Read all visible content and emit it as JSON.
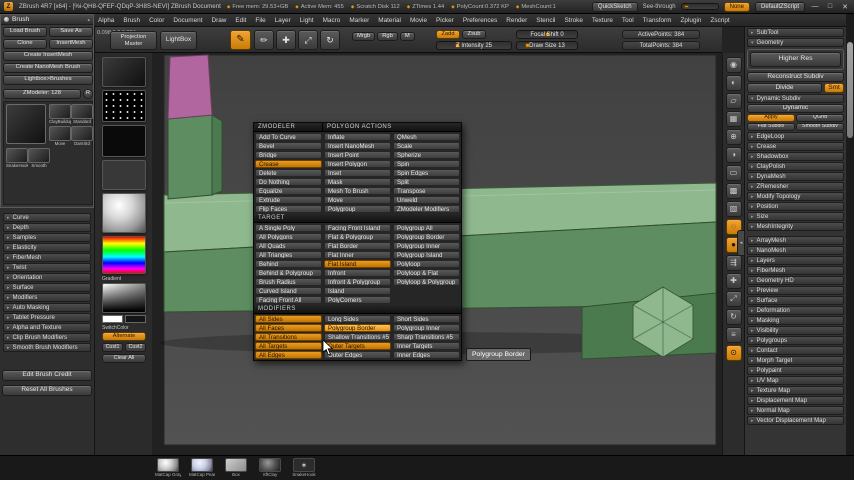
{
  "ui": {
    "stat_bullet": "◆",
    "collapse_arrow": "▸",
    "open_arrow": "▾",
    "collapse_up": "▴",
    "tray_handle": "◂",
    "r_badge": "R"
  },
  "colors": {
    "accent": "#e8930e",
    "mesh-top": "#8fb88f",
    "mesh-front": "#5d8d60",
    "mesh-side": "#4a7a4e",
    "mesh-pink": "#b266a0"
  },
  "titlebar": {
    "title": "ZBrush 4R7 [x64] - [%i-QH8-QFEF-QDqP-3H8S-NEVI]  ZBrush Document",
    "stats": [
      {
        "label": "Free mem: 29.53+GB"
      },
      {
        "label": "Active Mem: 455"
      },
      {
        "label": "Scratch Disk 112"
      },
      {
        "label": "ZTimes 1.44"
      },
      {
        "label": "PolyCount:0.372 KP"
      },
      {
        "label": "MeshCount:1"
      }
    ],
    "quicksketch": "QuickSketch",
    "see_through": "See-through",
    "none": "None",
    "zscript": "DefaultZScript",
    "win_min": "—",
    "win_max": "□",
    "win_close": "✕"
  },
  "menubar": {
    "items": [
      "Alpha",
      "Brush",
      "Color",
      "Document",
      "Draw",
      "Edit",
      "File",
      "Layer",
      "Light",
      "Macro",
      "Marker",
      "Material",
      "Movie",
      "Picker",
      "Preferences",
      "Render",
      "Stencil",
      "Stroke",
      "Texture",
      "Tool",
      "Transform",
      "Zplugin",
      "Zscript"
    ]
  },
  "shelf": {
    "coords": "0.098:0.2,0.884",
    "projection_master": "Projection Master",
    "lightbox": "LightBox",
    "edit_glyph": "✎",
    "nav": [
      {
        "name": "draw-button",
        "label": "Draw",
        "glyph": "✏"
      },
      {
        "name": "move-button",
        "label": "Move",
        "glyph": "✚"
      },
      {
        "name": "scale-button",
        "label": "Scale",
        "glyph": "⤢"
      },
      {
        "name": "rotate-button",
        "label": "Rotate",
        "glyph": "↻"
      }
    ],
    "modes": [
      "Mrgb",
      "Rgb",
      "M"
    ],
    "zadd": "Zadd",
    "zsub": "Zsub",
    "z_intensity": "Z Intensity 25",
    "focal_shift": "Focal Shift 0",
    "draw_size": "Draw Size 13",
    "active_points": "ActivePoints: 384",
    "total_points": "TotalPoints: 384"
  },
  "brush_palette": {
    "title": "Brush",
    "row1": [
      {
        "name": "load-brush-button",
        "label": "Load Brush"
      },
      {
        "name": "save-as-button",
        "label": "Save As"
      }
    ],
    "row2": [
      {
        "name": "clone-brush-button",
        "label": "Clone"
      },
      {
        "name": "insertmesh-button",
        "label": "InsertMesh"
      }
    ],
    "wide": [
      {
        "name": "create-insertmesh-button",
        "label": "Create InsertMesh"
      },
      {
        "name": "create-nanomesh-brush-button",
        "label": "Create NanoMesh Brush"
      },
      {
        "name": "lightbox-brushes-button",
        "label": "Lightbox>Brushes"
      }
    ],
    "zmodeler_count": "ZModeler: 128",
    "current_brush": "ZModeler",
    "thumbs_grid": [
      {
        "label": "ClayBuildup"
      },
      {
        "label": "Standard"
      },
      {
        "label": "Move"
      },
      {
        "label": "DamStd"
      }
    ],
    "thumbs_row": [
      {
        "label": "SnakeHook"
      },
      {
        "label": "Smooth"
      }
    ],
    "menus": [
      {
        "label": "Curve"
      },
      {
        "label": "Depth"
      },
      {
        "label": "Samples"
      },
      {
        "label": "Elasticity"
      },
      {
        "label": "FiberMesh"
      },
      {
        "label": "Twist"
      },
      {
        "label": "Orientation"
      },
      {
        "label": "Surface"
      },
      {
        "label": "Modifiers"
      },
      {
        "label": "Auto Masking"
      },
      {
        "label": "Tablet Pressure"
      },
      {
        "label": "Alpha and Texture"
      },
      {
        "label": "Clip Brush Modifiers"
      },
      {
        "label": "Smooth Brush Modifiers"
      }
    ],
    "credit": "Edit Brush Credit",
    "reset": "Reset All Brushes"
  },
  "left_shelf": {
    "gradient": "Gradient",
    "switch_color": "SwitchColor",
    "alternate": "Alternate",
    "cust": [
      "Cust1",
      "Cust2"
    ],
    "clear": "Clear All"
  },
  "zmodeler": {
    "title": "ZMODELER",
    "actions_header": "POLYGON ACTIONS",
    "actions_col1": [
      {
        "label": "Add To Curve"
      },
      {
        "label": "Bevel"
      },
      {
        "label": "Bridge"
      },
      {
        "label": "Crease",
        "on": true
      },
      {
        "label": "Delete"
      },
      {
        "label": "Do Nothing"
      },
      {
        "label": "Equalize"
      },
      {
        "label": "Extrude"
      },
      {
        "label": "Flip Faces"
      }
    ],
    "actions_col2": [
      {
        "label": "Inflate"
      },
      {
        "label": "Insert NanoMesh"
      },
      {
        "label": "Insert Point"
      },
      {
        "label": "Insert Polygon"
      },
      {
        "label": "Inset"
      },
      {
        "label": "Mask"
      },
      {
        "label": "Mesh To Brush"
      },
      {
        "label": "Move"
      },
      {
        "label": "Polygroup"
      }
    ],
    "actions_col3": [
      {
        "label": "QMesh"
      },
      {
        "label": "Scale"
      },
      {
        "label": "Spherize"
      },
      {
        "label": "Spin"
      },
      {
        "label": "Spin Edges"
      },
      {
        "label": "Split"
      },
      {
        "label": "Transpose"
      },
      {
        "label": "Unweld"
      },
      {
        "label": "ZModeler Modifiers"
      }
    ],
    "target_header": "TARGET",
    "targets_col1": [
      {
        "label": "A Single Poly"
      },
      {
        "label": "All Polygons"
      },
      {
        "label": "All Quads"
      },
      {
        "label": "All Triangles"
      },
      {
        "label": "Behind"
      },
      {
        "label": "Behind & Polygroup"
      },
      {
        "label": "Brush Radius"
      },
      {
        "label": "Curved Island"
      },
      {
        "label": "Facing Front All"
      }
    ],
    "targets_col2": [
      {
        "label": "Facing Front Island"
      },
      {
        "label": "Flat & Polygroup"
      },
      {
        "label": "Flat Border"
      },
      {
        "label": "Flat Inner"
      },
      {
        "label": "Flat Island",
        "on": true
      },
      {
        "label": "Infront"
      },
      {
        "label": "Infront & Polygroup"
      },
      {
        "label": "Island"
      },
      {
        "label": "PolyCorners"
      }
    ],
    "targets_col3": [
      {
        "label": "Polygroup All"
      },
      {
        "label": "Polygroup Border"
      },
      {
        "label": "Polygroup Inner"
      },
      {
        "label": "Polygroup Island"
      },
      {
        "label": "Polyloop"
      },
      {
        "label": "Polyloop & Flat"
      },
      {
        "label": "Polyloop & Polygroup"
      }
    ],
    "modifiers_header": "MODIFIERS",
    "modifiers_col1": [
      {
        "label": "All Sides",
        "on": true
      },
      {
        "label": "All Faces",
        "on": true
      },
      {
        "label": "All Transitions",
        "on": true
      },
      {
        "label": "All Targets",
        "on": true
      },
      {
        "label": "All Edges",
        "on": true
      }
    ],
    "modifiers_col2": [
      {
        "label": "Long Sides"
      },
      {
        "label": "Polygroup Border",
        "on": true,
        "hover": true
      },
      {
        "label": "Shallow Transitions #5"
      },
      {
        "label": "Outer Targets",
        "on": true
      },
      {
        "label": "Outer Edges"
      }
    ],
    "modifiers_col3": [
      {
        "label": "Short Sides"
      },
      {
        "label": "Polygroup Inner"
      },
      {
        "label": "Sharp Transitions #5"
      },
      {
        "label": "Inner Targets"
      },
      {
        "label": "Inner Edges"
      }
    ],
    "tooltip": "Polygroup Border"
  },
  "right_shelf": {
    "icons": [
      {
        "name": "bpr-icon",
        "glyph": "◉"
      },
      {
        "name": "render-mode-icon",
        "glyph": "◐"
      },
      {
        "name": "persp-icon",
        "glyph": "▱"
      },
      {
        "name": "floor-grid-icon",
        "glyph": "▦"
      },
      {
        "name": "local-transform-icon",
        "glyph": "⊕"
      },
      {
        "name": "lsym-icon",
        "glyph": "◑"
      },
      {
        "name": "frame-icon",
        "glyph": "▭"
      },
      {
        "name": "polyframe-icon",
        "glyph": "▩"
      },
      {
        "name": "transparency-icon",
        "glyph": "▨"
      },
      {
        "name": "ghost-icon",
        "glyph": "◌",
        "on": true
      },
      {
        "name": "solo-icon",
        "glyph": "●",
        "on": true
      },
      {
        "name": "xpose-icon",
        "glyph": "⇶"
      },
      {
        "name": "move-3d-icon",
        "glyph": "✚"
      },
      {
        "name": "scale-3d-icon",
        "glyph": "⤢"
      },
      {
        "name": "rotate-3d-icon",
        "glyph": "↻"
      },
      {
        "name": "scroll-doc-icon",
        "glyph": "≡"
      },
      {
        "name": "zoom-doc-icon",
        "glyph": "⊙",
        "on": true
      }
    ]
  },
  "right_tray": {
    "subtool": "SubTool",
    "geometry": "Geometry",
    "higher_res": "Higher Res",
    "reconstruct": "Reconstruct Subdiv",
    "divide": "Divide",
    "smt": "Smt",
    "dynamic_header": "Dynamic Subdiv",
    "dynamic": "Dynamic",
    "dyn_buttons": [
      {
        "label": "Apply",
        "on": true
      },
      {
        "label": "QGrid"
      },
      {
        "label": "Flat Subdiv"
      },
      {
        "label": "Smooth Subdiv"
      }
    ],
    "geo_sections": [
      {
        "label": "EdgeLoop"
      },
      {
        "label": "Crease"
      },
      {
        "label": "Shadowbox"
      },
      {
        "label": "ClayPolish"
      },
      {
        "label": "DynaMesh"
      },
      {
        "label": "ZRemesher"
      },
      {
        "label": "Modify Topology"
      },
      {
        "label": "Position"
      },
      {
        "label": "Size"
      },
      {
        "label": "MeshIntegrity"
      }
    ],
    "sections": [
      {
        "label": "ArrayMesh"
      },
      {
        "label": "NanoMesh"
      },
      {
        "label": "Layers"
      },
      {
        "label": "FiberMesh"
      },
      {
        "label": "Geometry HD"
      },
      {
        "label": "Preview"
      },
      {
        "label": "Surface"
      },
      {
        "label": "Deformation"
      },
      {
        "label": "Masking"
      },
      {
        "label": "Visibility"
      },
      {
        "label": "Polygroups"
      },
      {
        "label": "Contact"
      },
      {
        "label": "Morph Target"
      },
      {
        "label": "Polypaint"
      },
      {
        "label": "UV Map"
      },
      {
        "label": "Texture Map"
      },
      {
        "label": "Displacement Map"
      },
      {
        "label": "Normal Map"
      },
      {
        "label": "Vector Displacement Map"
      }
    ]
  },
  "bottom_tray": {
    "items": [
      {
        "label": "MatCap Gray",
        "kind": "k-sphere",
        "glyph": ""
      },
      {
        "label": "MatCap Pearl Gre",
        "kind": "k-sphere2",
        "glyph": ""
      },
      {
        "label": "Box",
        "kind": "k-cube",
        "glyph": ""
      },
      {
        "label": "SftClay",
        "kind": "k-dark",
        "glyph": ""
      },
      {
        "label": "SnakeHook",
        "kind": "k-star",
        "glyph": "✶"
      }
    ]
  }
}
